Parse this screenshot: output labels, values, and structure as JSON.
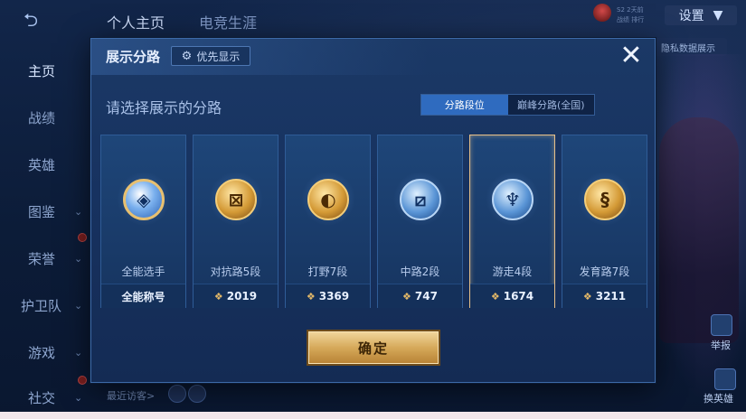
{
  "topbar": {
    "tabs": [
      "个人主页",
      "电竞生涯"
    ],
    "settings_label": "设置",
    "top_small_1": "S2 2天前",
    "top_small_2": "战绩 排行",
    "privacy_chip": "隐私数据展示"
  },
  "leftnav": {
    "items": [
      "主页",
      "战绩",
      "英雄",
      "图鉴",
      "荣誉",
      "护卫队",
      "游戏",
      "社交"
    ],
    "recent_visitors": "最近访客>"
  },
  "right_side": {
    "report_label": "举报",
    "change_hero_label": "换英雄"
  },
  "modal": {
    "title": "展示分路",
    "priority_label": "优先显示",
    "close_symbol": "✕",
    "subtitle": "请选择展示的分路",
    "segments": [
      {
        "label": "分路段位",
        "active": true
      },
      {
        "label": "巅峰分路(全国)",
        "active": false
      }
    ],
    "cards": [
      {
        "name": "全能选手",
        "footer": "全能称号",
        "icon": "allround-emblem-icon",
        "style": "allround",
        "glyph": "◈",
        "selected": false
      },
      {
        "name": "对抗路5段",
        "footer": "2019",
        "icon": "clash-lane-emblem-icon",
        "style": "gold",
        "glyph": "⊠",
        "selected": false
      },
      {
        "name": "打野7段",
        "footer": "3369",
        "icon": "jungle-emblem-icon",
        "style": "gold",
        "glyph": "◐",
        "selected": false
      },
      {
        "name": "中路2段",
        "footer": "747",
        "icon": "mid-lane-emblem-icon",
        "style": "blue",
        "glyph": "⧄",
        "selected": false
      },
      {
        "name": "游走4段",
        "footer": "1674",
        "icon": "roam-emblem-icon",
        "style": "blue",
        "glyph": "♆",
        "selected": true
      },
      {
        "name": "发育路7段",
        "footer": "3211",
        "icon": "farm-lane-emblem-icon",
        "style": "gold",
        "glyph": "§",
        "selected": false
      }
    ],
    "confirm_label": "确定"
  },
  "colors": {
    "accent_blue": "#2f6bbf",
    "gold": "#d6a95a",
    "selected_border": "#e7c089"
  }
}
